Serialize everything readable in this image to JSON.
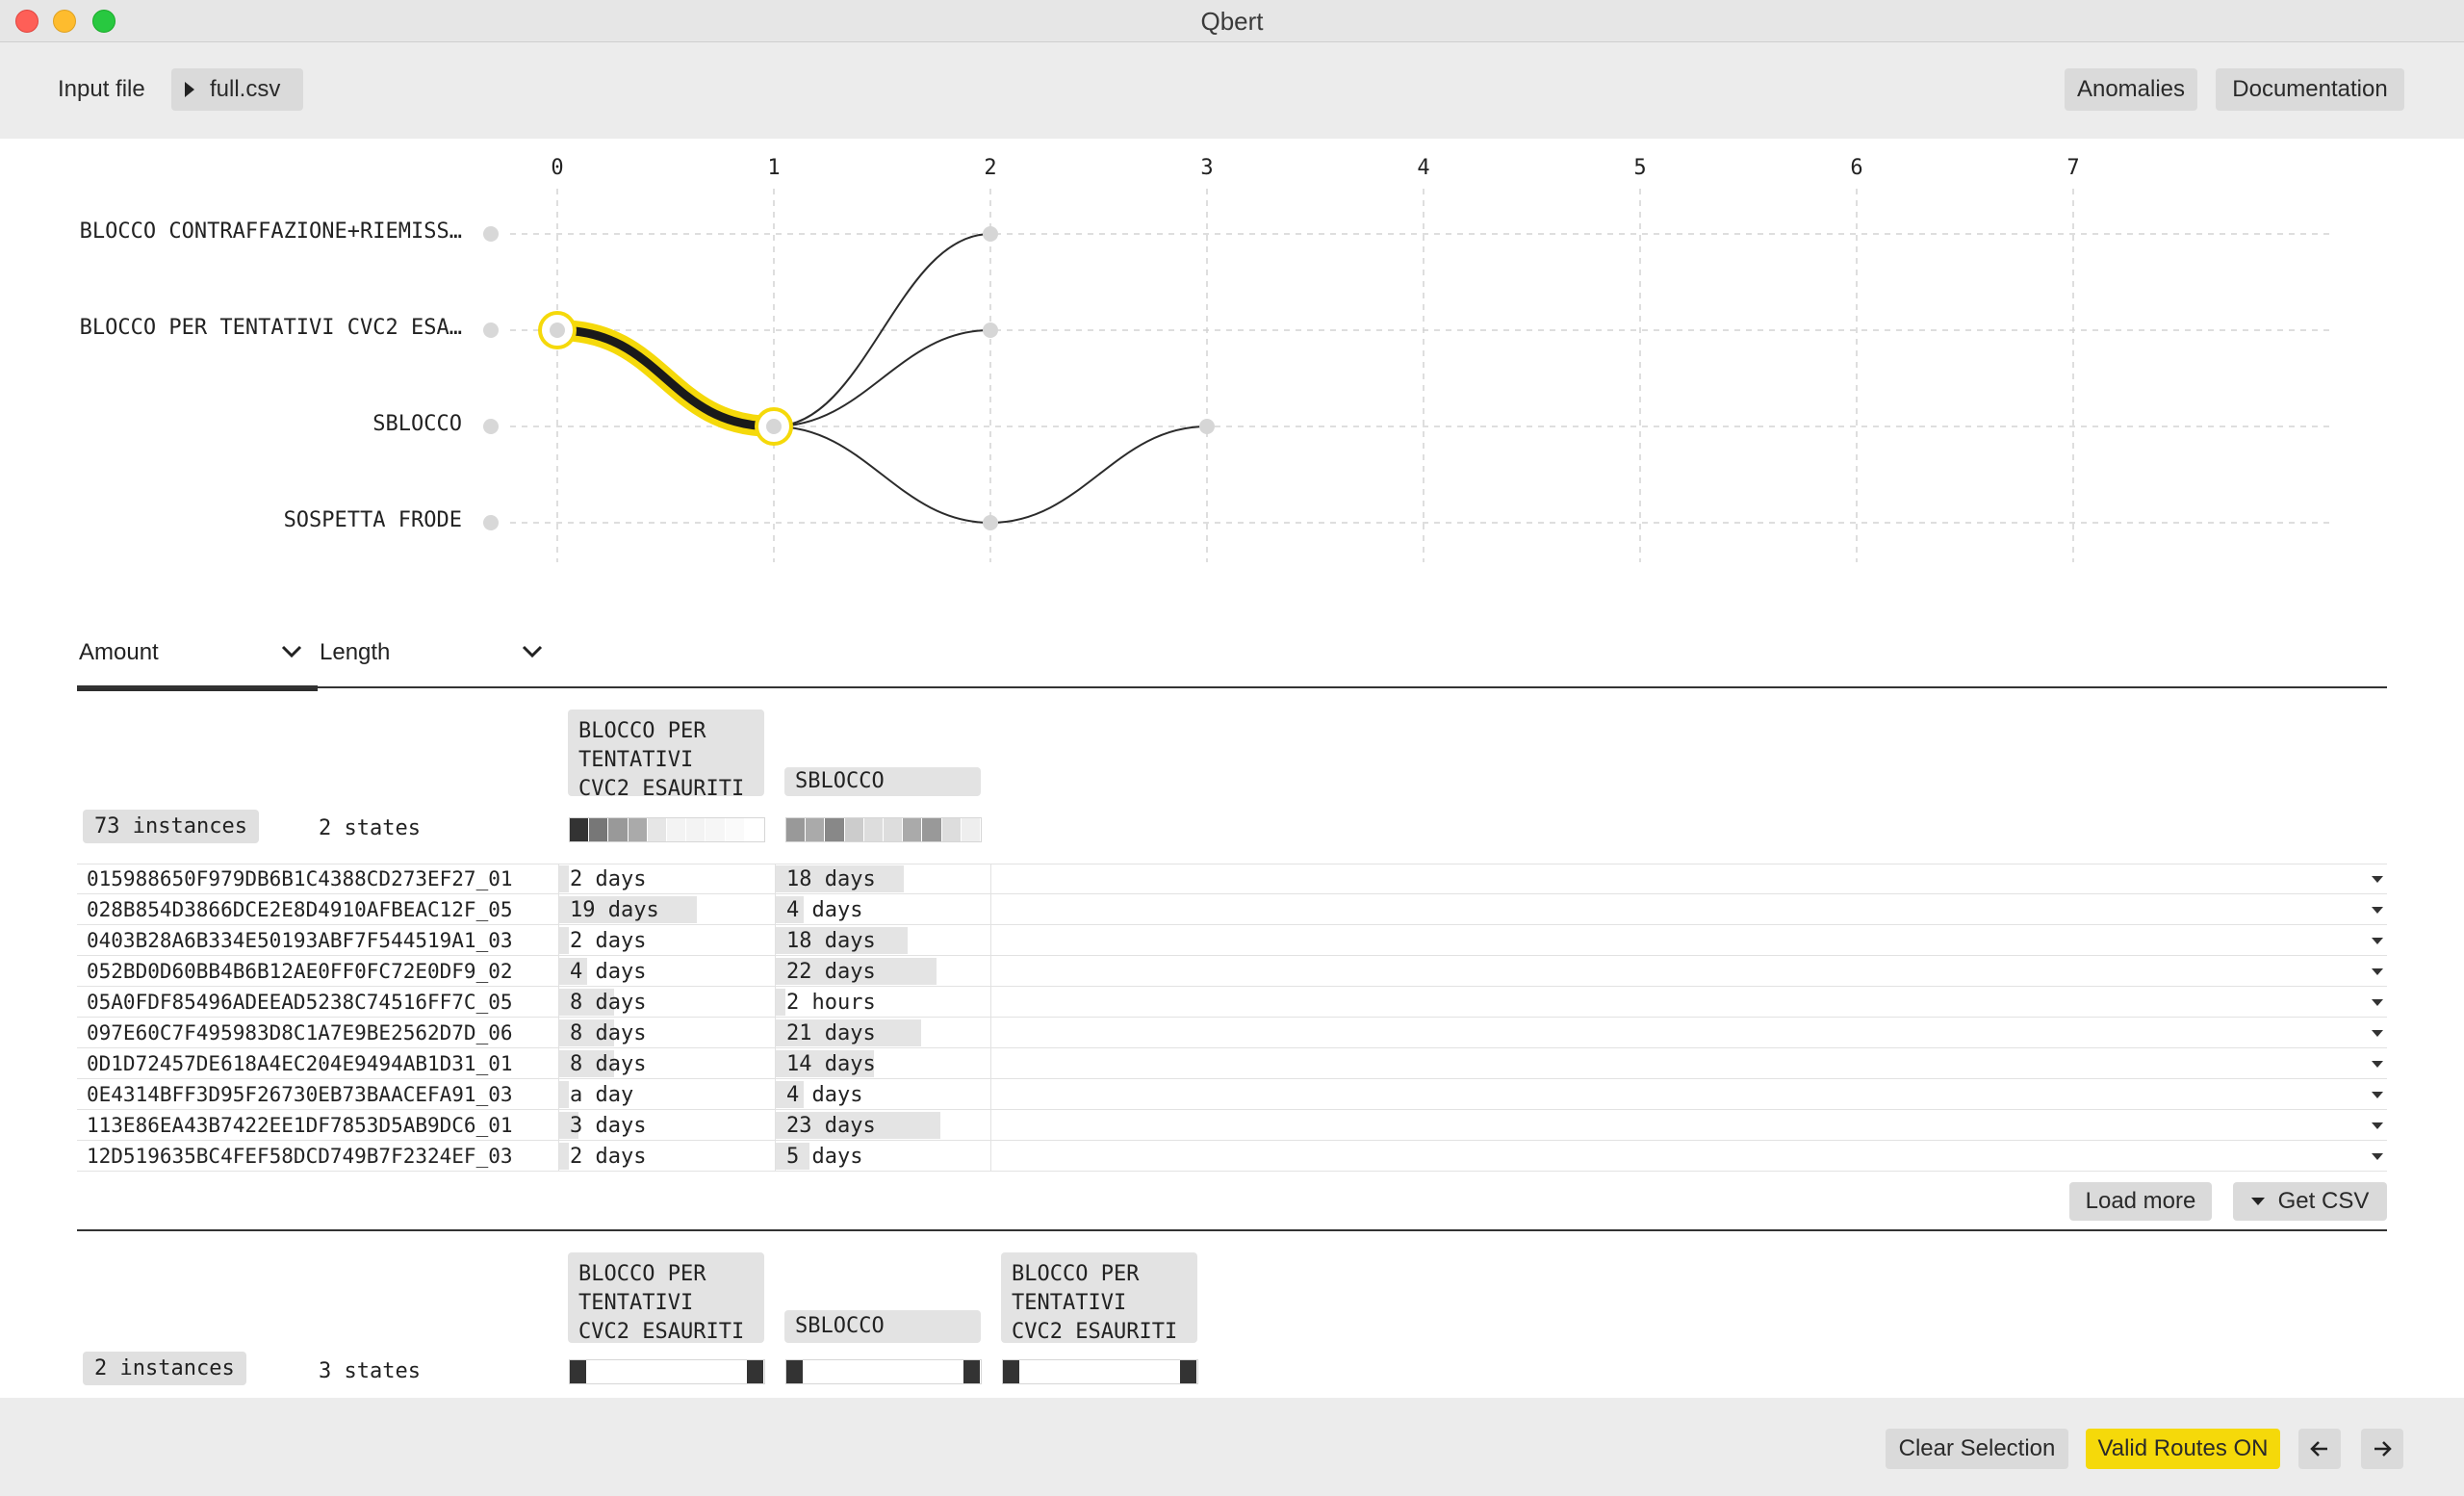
{
  "window": {
    "title": "Qbert"
  },
  "toolbar": {
    "input_label": "Input file",
    "file_name": "full.csv",
    "anomalies_label": "Anomalies",
    "documentation_label": "Documentation"
  },
  "graph": {
    "axis_numbers": [
      "0",
      "1",
      "2",
      "3",
      "4",
      "5",
      "6",
      "7"
    ],
    "states": [
      "BLOCCO CONTRAFFAZIONE+RIEMISS…",
      "BLOCCO PER TENTATIVI CVC2 ESA…",
      "SBLOCCO",
      "SOSPETTA FRODE"
    ],
    "highlight_color": "#f5d90a",
    "selected_route": [
      "BLOCCO PER TENTATIVI CVC2 ESA…",
      "SBLOCCO"
    ]
  },
  "tabs": {
    "amount_label": "Amount",
    "length_label": "Length"
  },
  "group1": {
    "instances": "73 instances",
    "states_count": "2 states",
    "state_names": [
      "BLOCCO PER\nTENTATIVI\nCVC2 ESAURITI",
      "SBLOCCO"
    ],
    "rows": [
      {
        "id": "015988650F979DB6B1C4388CD273EF27_01",
        "c1": "2 days",
        "c1_frac": 0.05,
        "c2": "18 days",
        "c2_frac": 0.65
      },
      {
        "id": "028B854D3866DCE2E8D4910AFBEAC12F_05",
        "c1": "19 days",
        "c1_frac": 0.7,
        "c2": "4 days",
        "c2_frac": 0.14
      },
      {
        "id": "0403B28A6B334E50193ABF7F544519A1_03",
        "c1": "2 days",
        "c1_frac": 0.05,
        "c2": "18 days",
        "c2_frac": 0.67
      },
      {
        "id": "052BD0D60BB4B6B12AE0FF0FC72E0DF9_02",
        "c1": "4 days",
        "c1_frac": 0.14,
        "c2": "22 days",
        "c2_frac": 0.82
      },
      {
        "id": "05A0FDF85496ADEEAD5238C74516FF7C_05",
        "c1": "8 days",
        "c1_frac": 0.28,
        "c2": "2 hours",
        "c2_frac": 0.0
      },
      {
        "id": "097E60C7F495983D8C1A7E9BE2562D7D_06",
        "c1": "8 days",
        "c1_frac": 0.28,
        "c2": "21 days",
        "c2_frac": 0.74
      },
      {
        "id": "0D1D72457DE618A4EC204E9494AB1D31_01",
        "c1": "8 days",
        "c1_frac": 0.28,
        "c2": "14 days",
        "c2_frac": 0.5
      },
      {
        "id": "0E4314BFF3D95F26730EB73BAACEFA91_03",
        "c1": "a day",
        "c1_frac": 0.02,
        "c2": "4 days",
        "c2_frac": 0.14
      },
      {
        "id": "113E86EA43B7422EE1DF7853D5AB9DC6_01",
        "c1": "3 days",
        "c1_frac": 0.1,
        "c2": "23 days",
        "c2_frac": 0.84
      },
      {
        "id": "12D519635BC4FEF58DCD749B7F2324EF_03",
        "c1": "2 days",
        "c1_frac": 0.05,
        "c2": "5 days",
        "c2_frac": 0.17
      }
    ],
    "load_more_label": "Load more",
    "get_csv_label": "Get CSV"
  },
  "group2": {
    "instances": "2 instances",
    "states_count": "3 states",
    "state_names": [
      "BLOCCO PER\nTENTATIVI\nCVC2 ESAURITI",
      "SBLOCCO",
      "BLOCCO PER\nTENTATIVI\nCVC2 ESAURITI"
    ]
  },
  "bottombar": {
    "clear_selection_label": "Clear Selection",
    "valid_routes_label": "Valid Routes ON",
    "valid_routes_color": "#f5d90a",
    "back_icon": "arrow-left-icon",
    "forward_icon": "arrow-right-icon"
  }
}
